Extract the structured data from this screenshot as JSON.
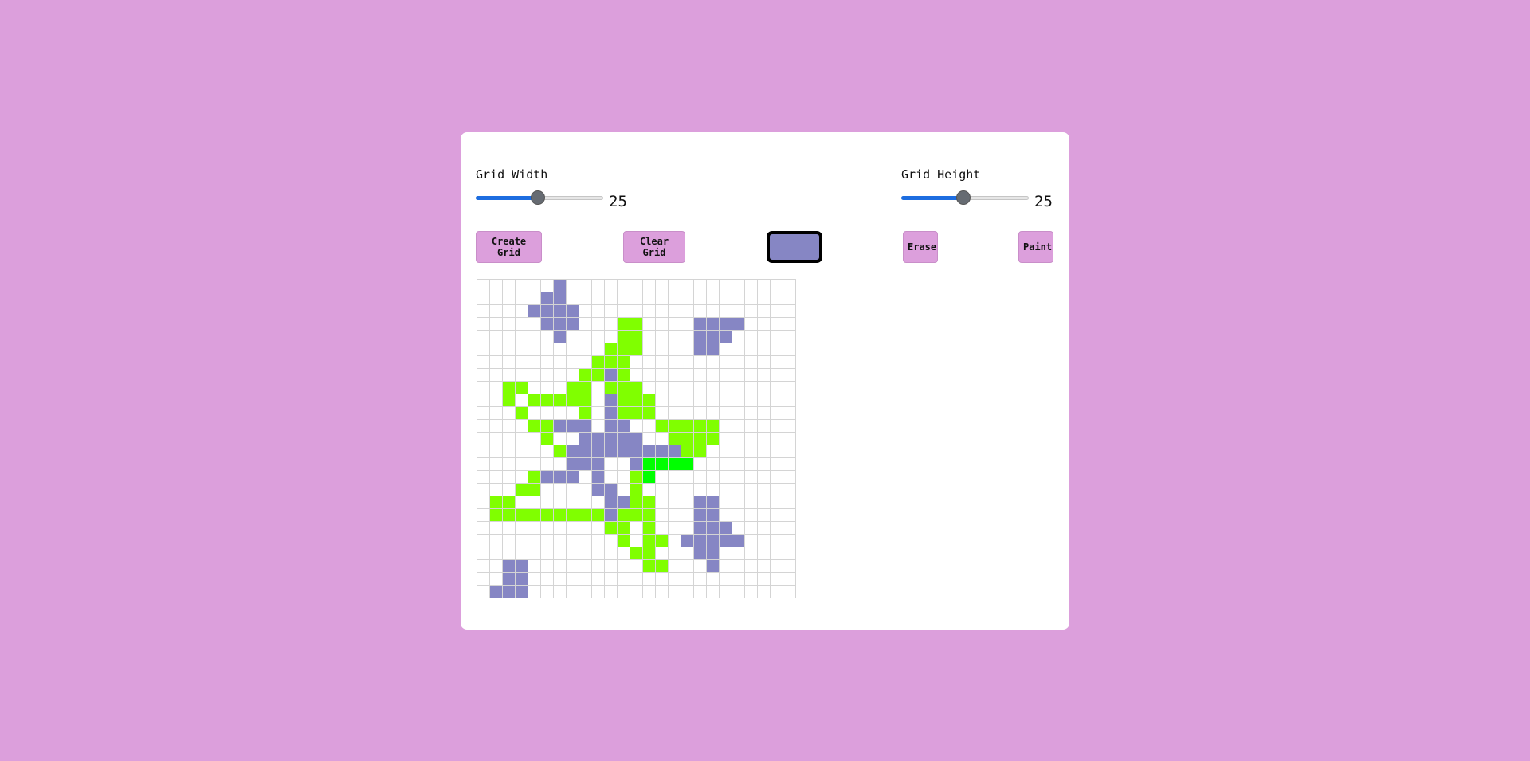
{
  "controls": {
    "width_label": "Grid Width",
    "width_value": 25,
    "height_label": "Grid Height",
    "height_value": 25,
    "slider_min": 1,
    "slider_max": 50
  },
  "buttons": {
    "create": "Create Grid",
    "clear": "Clear Grid",
    "erase": "Erase",
    "paint": "Paint"
  },
  "selected_color": "#8686c4",
  "palette": {
    ".": "#ffffff",
    "p": "#8686c4",
    "g": "#80ff00",
    "G": "#00ff00"
  },
  "grid": [
    "......p..................",
    ".....pp..................",
    "....pppp.................",
    ".....ppp...gg....pppp....",
    "......p....gg....ppp.....",
    "..........ggg....pp......",
    ".........ggg.............",
    "........ggpg.............",
    "..gg...gg.ggg............",
    "..g.ggggg.pggg...........",
    "...g....g.pggg...........",
    "....ggppp.pp..ggggg......",
    ".....g..ppppp..gggg......",
    "......gpppppppppgg.......",
    ".......ppp..pGGGG........",
    "....gppp.p..gG...........",
    "...gg....pp.g............",
    ".gg.......ppgg...pp......",
    ".gggggggggpggg...pp......",
    "..........gg.g...ppp.....",
    "...........g.gg.ppppp....",
    "............gg...pp......",
    "..pp.........gg...p......",
    "..pp.....................",
    ".ppp....................."
  ]
}
